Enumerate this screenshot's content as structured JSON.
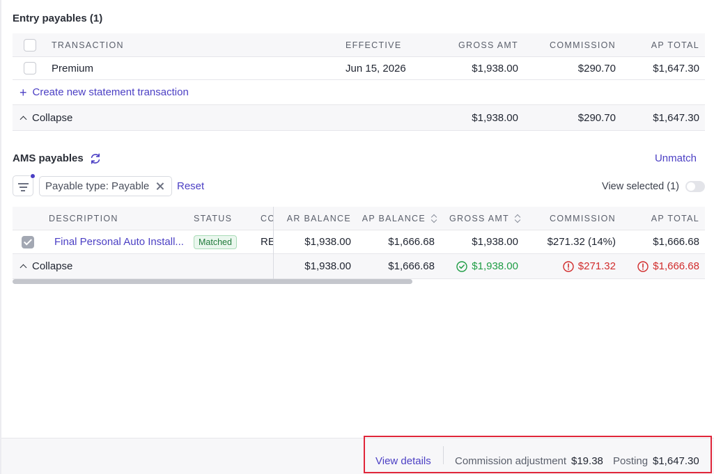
{
  "entry": {
    "title": "Entry payables (1)",
    "columns": [
      "TRANSACTION",
      "EFFECTIVE",
      "GROSS AMT",
      "COMMISSION",
      "AP TOTAL"
    ],
    "rows": [
      {
        "transaction": "Premium",
        "effective": "Jun 15, 2026",
        "gross": "$1,938.00",
        "commission": "$290.70",
        "ap_total": "$1,647.30",
        "checked": false
      }
    ],
    "create_label": "Create new statement transaction",
    "collapse_label": "Collapse",
    "totals": {
      "gross": "$1,938.00",
      "commission": "$290.70",
      "ap_total": "$1,647.30"
    }
  },
  "ams": {
    "title": "AMS payables",
    "unmatch_label": "Unmatch",
    "filter_chip": "Payable type: Payable",
    "reset_label": "Reset",
    "view_selected_label": "View selected (1)",
    "view_selected_on": false,
    "columns": [
      "DESCRIPTION",
      "STATUS",
      "CO",
      "AR BALANCE",
      "AP BALANCE",
      "GROSS AMT",
      "COMMISSION",
      "AP TOTAL"
    ],
    "rows": [
      {
        "description": "Final Personal Auto Install...",
        "status": "Matched",
        "co": "RE",
        "ar_balance": "$1,938.00",
        "ap_balance": "$1,666.68",
        "gross": "$1,938.00",
        "commission": "$271.32 (14%)",
        "ap_total": "$1,666.68",
        "checked": true
      }
    ],
    "collapse_label": "Collapse",
    "totals": {
      "ar_balance": "$1,938.00",
      "ap_balance": "$1,666.68",
      "gross": "$1,938.00",
      "commission": "$271.32",
      "ap_total": "$1,666.68"
    },
    "colors": {
      "ok": "#1f9d45",
      "error": "#d12c2c"
    }
  },
  "footer": {
    "view_details_label": "View details",
    "commission_adjustment_label": "Commission adjustment",
    "commission_adjustment_value": "$19.38",
    "posting_label": "Posting",
    "posting_value": "$1,647.30",
    "highlight_color": "#e0263a"
  },
  "colors": {
    "accent": "#4b3fc4"
  }
}
